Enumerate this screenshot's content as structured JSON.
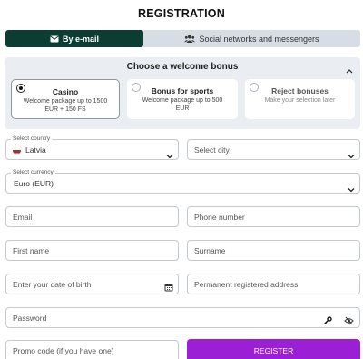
{
  "page": {
    "title": "REGISTRATION"
  },
  "tabs": [
    {
      "label": "By e-mail",
      "icon": "envelope-icon",
      "active": true
    },
    {
      "label": "Social networks and messengers",
      "icon": "users-icon",
      "active": false
    }
  ],
  "bonus": {
    "heading": "Choose a welcome bonus",
    "options": [
      {
        "title": "Casino",
        "desc": "Welcome package up to 1500 EUR + 150 FS",
        "selected": true
      },
      {
        "title": "Bonus for sports",
        "desc": "Welcome package up to 500 EUR",
        "selected": false
      },
      {
        "title": "Reject bonuses",
        "desc": "Make your selection later",
        "selected": false
      }
    ]
  },
  "form": {
    "country": {
      "label": "Select country",
      "value": "Latvia"
    },
    "city": {
      "placeholder": "Select city"
    },
    "currency": {
      "label": "Select currency",
      "value": "Euro (EUR)"
    },
    "email": {
      "placeholder": "Email"
    },
    "phone": {
      "placeholder": "Phone number"
    },
    "first_name": {
      "placeholder": "First name"
    },
    "surname": {
      "placeholder": "Surname"
    },
    "dob": {
      "placeholder": "Enter your date of birth"
    },
    "address": {
      "placeholder": "Permanent registered address"
    },
    "password": {
      "placeholder": "Password"
    },
    "promo": {
      "placeholder": "Promo code (if you have one)"
    },
    "register_label": "REGISTER"
  },
  "colors": {
    "tab_active": "#0c3d32",
    "tab_inactive": "#d7dde4",
    "panel_bg": "#eaeef3",
    "register": "#9b1fd4",
    "flag_red": "#9e3039"
  }
}
